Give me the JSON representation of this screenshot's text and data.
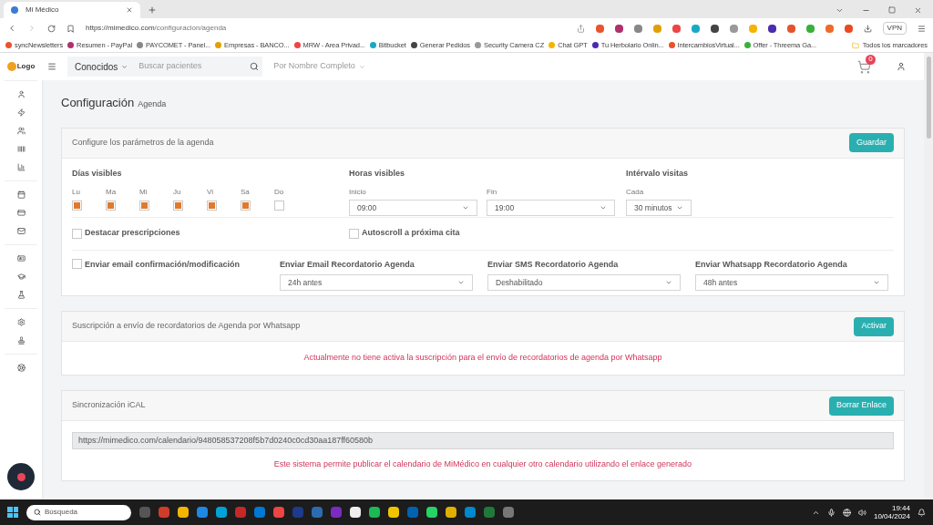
{
  "browser": {
    "tab_title": "Mi Médico",
    "url_host": "https://mimedico.com",
    "url_path": "/configuracion/agenda",
    "vpn": "VPN",
    "bookmarks": [
      "syncNewsletters",
      "Resumen - PayPal",
      "PAYCOMET - Panel...",
      "Empresas - BANCO...",
      "MRW - Area Privad...",
      "Bitbucket",
      "Generar Pedidos",
      "Security Camera CZ",
      "Chat GPT",
      "Tu Herbolario Onlin...",
      "IntercambiosVirtual...",
      "Offer - Threema Ga..."
    ],
    "all_bookmarks": "Todos los marcadores"
  },
  "header": {
    "filter": "Conocidos",
    "search_placeholder": "Buscar pacientes",
    "search_mode": "Por Nombre Completo",
    "cart_count": "0",
    "logo": "Logo"
  },
  "page": {
    "title": "Configuración",
    "subtitle": "Agenda"
  },
  "agenda_panel": {
    "heading": "Configure los parámetros de la agenda",
    "button": "Guardar",
    "days_label": "Días visibles",
    "days": [
      {
        "label": "Lu",
        "checked": true
      },
      {
        "label": "Ma",
        "checked": true
      },
      {
        "label": "Mi",
        "checked": true
      },
      {
        "label": "Ju",
        "checked": true
      },
      {
        "label": "Vi",
        "checked": true
      },
      {
        "label": "Sa",
        "checked": true
      },
      {
        "label": "Do",
        "checked": false
      }
    ],
    "hours_label": "Horas visibles",
    "start_label": "Inicio",
    "start_value": "09:00",
    "end_label": "Fin",
    "end_value": "19:00",
    "interval_label": "Intérvalo visitas",
    "interval_sub": "Cada",
    "interval_value": "30 minutos",
    "options": [
      {
        "label": "Destacar prescripciones",
        "checked": false
      },
      {
        "label": "Autoscroll a próxima cita",
        "checked": false
      }
    ],
    "email_confirm": {
      "label": "Enviar email confirmación/modificación",
      "checked": false
    },
    "reminders": [
      {
        "label": "Enviar Email Recordatorio Agenda",
        "value": "24h antes"
      },
      {
        "label": "Enviar SMS Recordatorio Agenda",
        "value": "Deshabilitado"
      },
      {
        "label": "Enviar Whatsapp Recordatorio Agenda",
        "value": "48h antes"
      }
    ]
  },
  "whatsapp_panel": {
    "heading": "Suscripción a envío de recordatorios de Agenda por Whatsapp",
    "button": "Activar",
    "message": "Actualmente no tiene activa la suscripción para el envío de recordatorios de agenda por Whatsapp"
  },
  "ical_panel": {
    "heading": "Sincronización iCAL",
    "button": "Borrar Enlace",
    "link": "https://mimedico.com/calendario/948058537208f5b7d0240c0cd30aa187ff60580b",
    "message": "Este sistema permite publicar el calendario de MiMédico en cualquier otro calendario utilizando el enlace generado"
  },
  "taskbar": {
    "search_placeholder": "Búsqueda",
    "time": "19:44",
    "date": "10/04/2024"
  }
}
